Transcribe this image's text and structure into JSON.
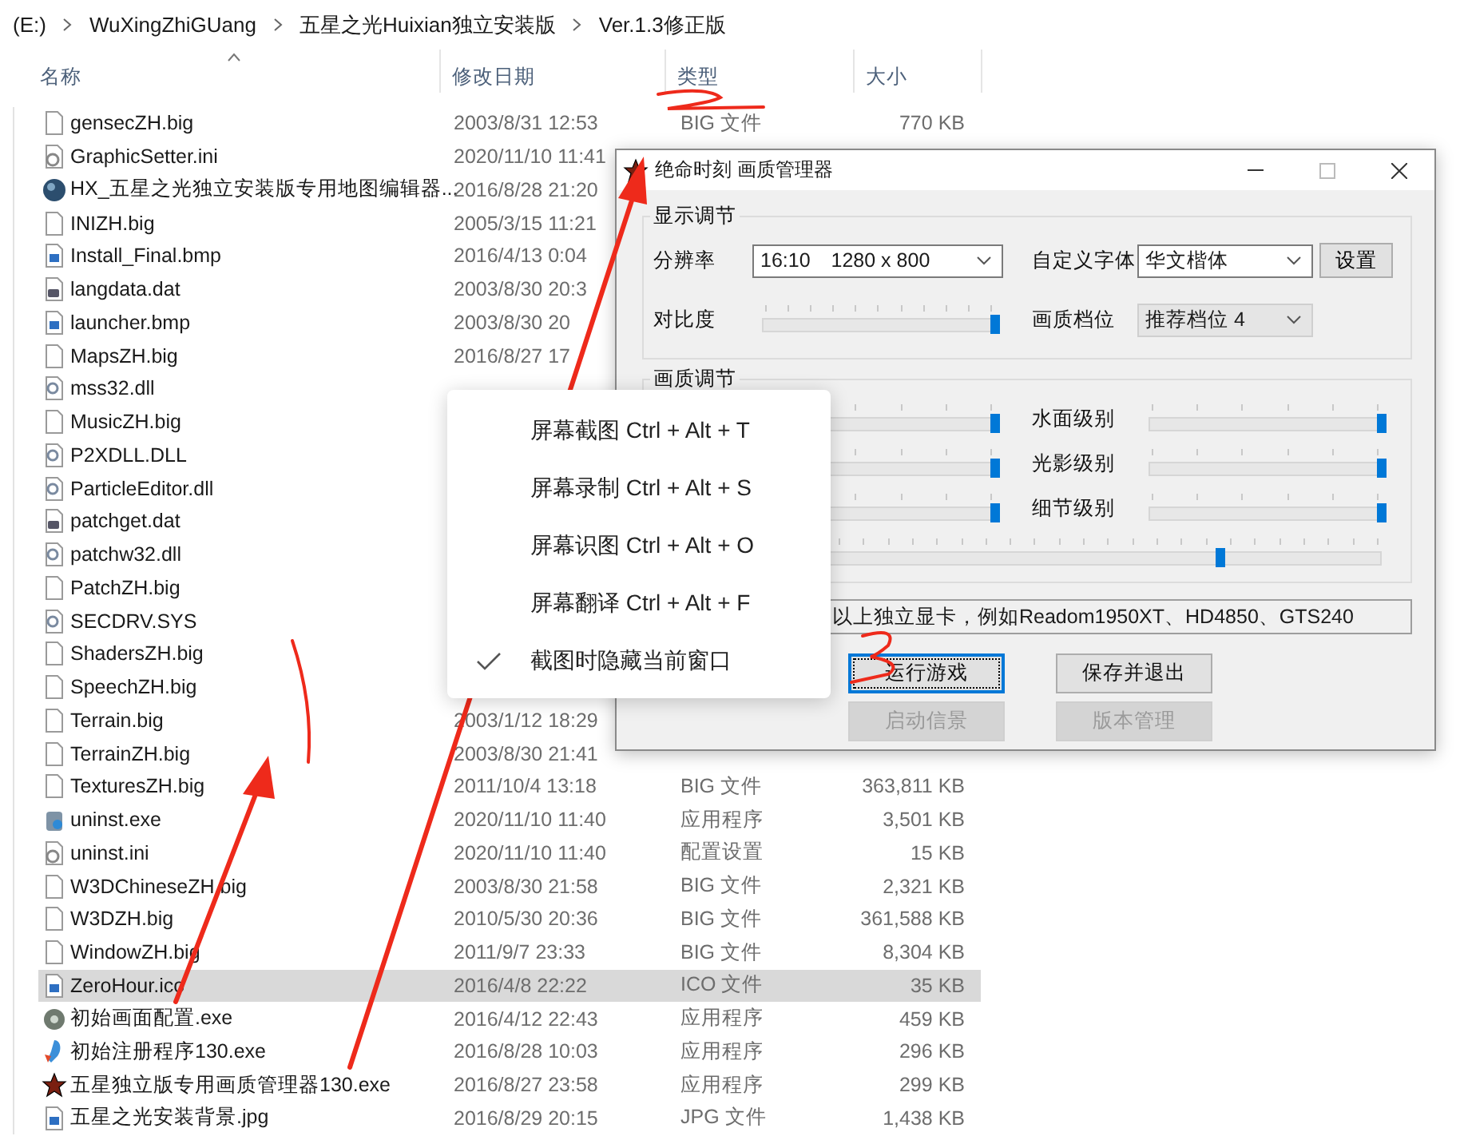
{
  "breadcrumb": [
    "(E:)",
    "WuXingZhiGUang",
    "五星之光Huixian独立安装版",
    "Ver.1.3修正版"
  ],
  "columns": [
    {
      "label": "名称",
      "sorted": true
    },
    {
      "label": "修改日期",
      "sorted": false
    },
    {
      "label": "类型",
      "sorted": false
    },
    {
      "label": "大小",
      "sorted": false
    }
  ],
  "files": [
    {
      "name": "gensecZH.big",
      "kind": "blank",
      "date": "2003/8/31 12:53",
      "type": "BIG 文件",
      "size": "770 KB",
      "selected": false
    },
    {
      "name": "GraphicSetter.ini",
      "kind": "settings",
      "date": "2020/11/10 11:41",
      "selected": false
    },
    {
      "name": "HX_五星之光独立安装版专用地图编辑器...",
      "kind": "globe",
      "date": "2016/8/28 21:20",
      "selected": false
    },
    {
      "name": "INIZH.big",
      "kind": "blank",
      "date": "2005/3/15 11:21",
      "selected": false
    },
    {
      "name": "Install_Final.bmp",
      "kind": "image",
      "date": "2016/4/13 0:04",
      "selected": false
    },
    {
      "name": "langdata.dat",
      "kind": "data",
      "date": "2003/8/30 20:3",
      "selected": false
    },
    {
      "name": "launcher.bmp",
      "kind": "image",
      "date": "2003/8/30 20",
      "selected": false
    },
    {
      "name": "MapsZH.big",
      "kind": "blank",
      "date": "2016/8/27 17",
      "selected": false
    },
    {
      "name": "mss32.dll",
      "kind": "library",
      "selected": false
    },
    {
      "name": "MusicZH.big",
      "kind": "blank",
      "selected": false
    },
    {
      "name": "P2XDLL.DLL",
      "kind": "library",
      "selected": false
    },
    {
      "name": "ParticleEditor.dll",
      "kind": "library",
      "selected": false
    },
    {
      "name": "patchget.dat",
      "kind": "data",
      "selected": false
    },
    {
      "name": "patchw32.dll",
      "kind": "library",
      "selected": false
    },
    {
      "name": "PatchZH.big",
      "kind": "blank",
      "selected": false
    },
    {
      "name": "SECDRV.SYS",
      "kind": "library",
      "selected": false
    },
    {
      "name": "ShadersZH.big",
      "kind": "blank",
      "selected": false
    },
    {
      "name": "SpeechZH.big",
      "kind": "blank",
      "selected": false
    },
    {
      "name": "Terrain.big",
      "kind": "blank",
      "date": "2003/1/12 18:29",
      "selected": false
    },
    {
      "name": "TerrainZH.big",
      "kind": "blank",
      "date": "2003/8/30 21:41",
      "selected": false
    },
    {
      "name": "TexturesZH.big",
      "kind": "blank",
      "date": "2011/10/4 13:18",
      "type": "BIG 文件",
      "size": "363,811 KB",
      "selected": false
    },
    {
      "name": "uninst.exe",
      "kind": "uninstaller",
      "date": "2020/11/10 11:40",
      "type": "应用程序",
      "size": "3,501 KB",
      "selected": false
    },
    {
      "name": "uninst.ini",
      "kind": "settings",
      "date": "2020/11/10 11:40",
      "type": "配置设置",
      "size": "15 KB",
      "selected": false
    },
    {
      "name": "W3DChineseZH.big",
      "kind": "blank",
      "date": "2003/8/30 21:58",
      "type": "BIG 文件",
      "size": "2,321 KB",
      "selected": false
    },
    {
      "name": "W3DZH.big",
      "kind": "blank",
      "date": "2010/5/30 20:36",
      "type": "BIG 文件",
      "size": "361,588 KB",
      "selected": false
    },
    {
      "name": "WindowZH.big",
      "kind": "blank",
      "date": "2011/9/7 23:33",
      "type": "BIG 文件",
      "size": "8,304 KB",
      "selected": false
    },
    {
      "name": "ZeroHour.ico",
      "kind": "image",
      "date": "2016/4/8 22:22",
      "type": "ICO 文件",
      "size": "35 KB",
      "selected": true
    },
    {
      "name": "初始画面配置.exe",
      "kind": "gear",
      "date": "2016/4/12 22:43",
      "type": "应用程序",
      "size": "459 KB",
      "selected": false
    },
    {
      "name": "初始注册程序130.exe",
      "kind": "installer",
      "date": "2016/8/28 10:03",
      "type": "应用程序",
      "size": "296 KB",
      "selected": false
    },
    {
      "name": "五星独立版专用画质管理器130.exe",
      "kind": "star",
      "date": "2016/8/27 23:58",
      "type": "应用程序",
      "size": "299 KB",
      "selected": false
    },
    {
      "name": "五星之光安装背景.jpg",
      "kind": "image",
      "date": "2016/8/29 20:15",
      "type": "JPG 文件",
      "size": "1,438 KB",
      "selected": false
    }
  ],
  "dialog": {
    "title": "绝命时刻 画质管理器",
    "display_group": {
      "title": "显示调节",
      "resolution": {
        "label": "分辨率",
        "value": "16:10　1280 x 800"
      },
      "font": {
        "label": "自定义字体",
        "value": "华文楷体",
        "button": "设置"
      },
      "contrast": {
        "label": "对比度",
        "level": 1
      },
      "preset": {
        "label": "画质档位",
        "value": "推荐档位 4"
      }
    },
    "quality_group": {
      "title": "画质调节",
      "left_sliders": [
        {
          "level": 1
        },
        {
          "level": 1
        },
        {
          "level": 1
        }
      ],
      "right_sliders": [
        {
          "label": "水面级别",
          "level": 1
        },
        {
          "label": "光影级别",
          "level": 1
        },
        {
          "label": "细节级别",
          "level": 1
        }
      ],
      "wide_slider": {
        "level": 0.74
      }
    },
    "note": "以上独立显卡，例如Readom1950XT、HD4850、GTS240",
    "buttons": [
      {
        "label": "运行游戏",
        "focused": true,
        "disabled": false
      },
      {
        "label": "保存并退出",
        "focused": false,
        "disabled": false
      },
      {
        "label": "启动信景",
        "focused": false,
        "disabled": true
      },
      {
        "label": "版本管理",
        "focused": false,
        "disabled": true
      }
    ]
  },
  "context_menu": {
    "items": [
      {
        "label": "屏幕截图 Ctrl + Alt + T",
        "checked": false
      },
      {
        "label": "屏幕录制 Ctrl + Alt + S",
        "checked": false
      },
      {
        "label": "屏幕识图 Ctrl + Alt + O",
        "checked": false
      },
      {
        "label": "屏幕翻译 Ctrl + Alt + F",
        "checked": false
      },
      {
        "label": "截图时隐藏当前窗口",
        "checked": true
      }
    ]
  }
}
